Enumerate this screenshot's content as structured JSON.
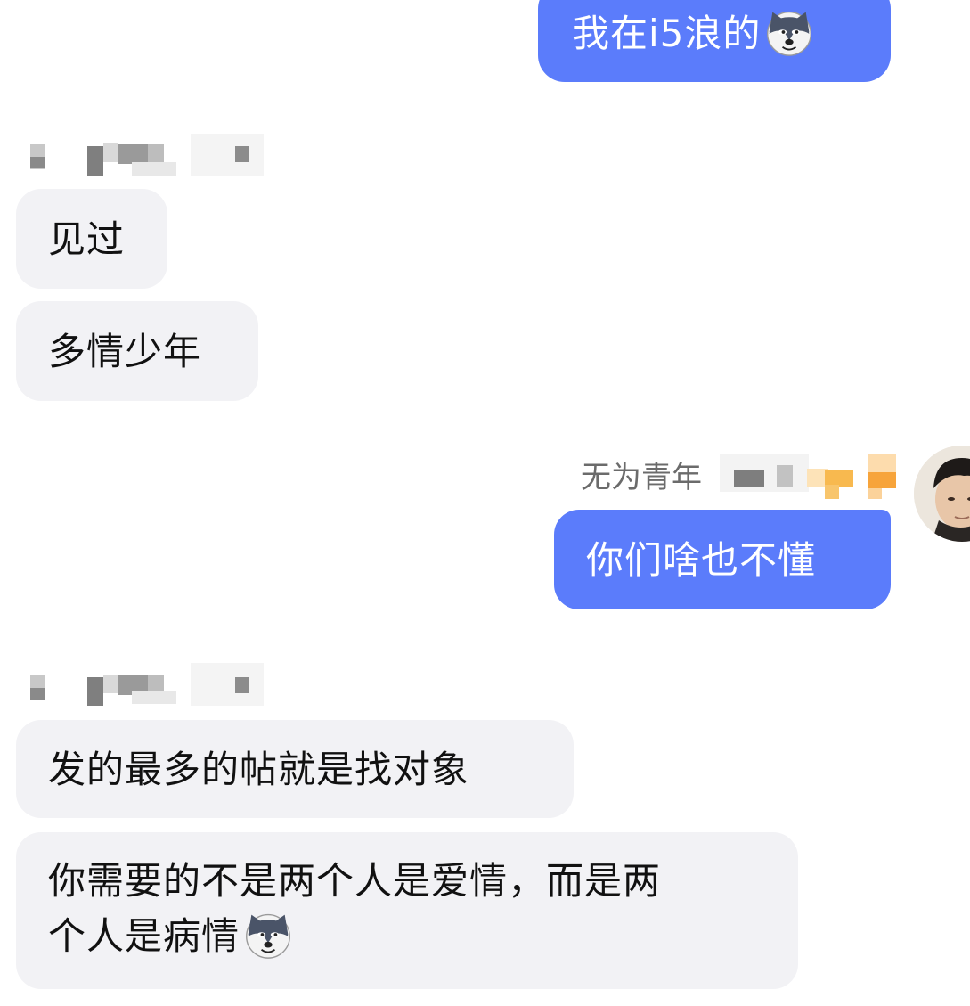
{
  "messages": {
    "m1": {
      "text": "我在i5浪的",
      "emoji": "husky-emoji"
    },
    "m2": {
      "text": "见过"
    },
    "m3": {
      "text": "多情少年"
    },
    "m4": {
      "sender": "无为青年",
      "text": "你们啥也不懂"
    },
    "m5": {
      "text": "发的最多的帖就是找对象"
    },
    "m6": {
      "line1": "你需要的不是两个人是爱情，而是两",
      "line2": "个人是病情",
      "emoji": "husky-emoji"
    }
  },
  "colors": {
    "outgoing_bubble": "#5b7cfb",
    "incoming_bubble": "#f2f2f5",
    "sender_name": "#6b6b6b"
  }
}
